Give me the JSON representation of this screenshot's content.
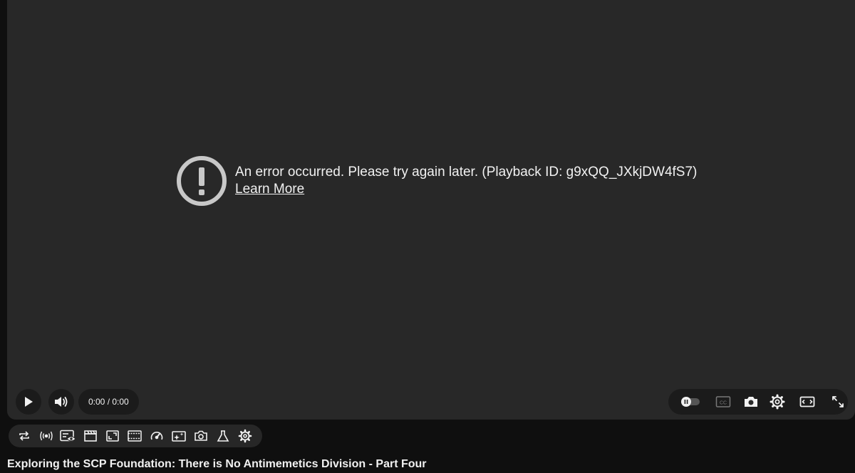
{
  "player": {
    "error": {
      "message": "An error occurred. Please try again later. (Playback ID: g9xQQ_JXkjDW4fS7)",
      "link_text": "Learn More"
    },
    "controls": {
      "time_display": "0:00 / 0:00",
      "left_icons": [
        "play-icon",
        "volume-icon"
      ],
      "right_icons": [
        "autoplay-toggle-icon",
        "closed-captions-icon",
        "screenshot-camera-icon",
        "settings-gear-icon",
        "theater-mode-icon",
        "fullscreen-icon"
      ],
      "captions_label": "CC"
    }
  },
  "extension_toolbar": {
    "icons": [
      "loop-icon",
      "broadcast-icon",
      "watched-eye-icon",
      "clapperboard-icon",
      "picture-in-picture-icon",
      "filmstrip-icon",
      "speedometer-icon",
      "sparkle-screen-icon",
      "camera-icon",
      "flask-icon",
      "gear-icon"
    ]
  },
  "video": {
    "title": "Exploring the SCP Foundation: There is No Antimemetics Division - Part Four"
  },
  "colors": {
    "player_bg": "#282828",
    "page_bg": "#0f0f0f",
    "icon": "#f1f1f1",
    "error_icon": "#c8c8c8"
  }
}
